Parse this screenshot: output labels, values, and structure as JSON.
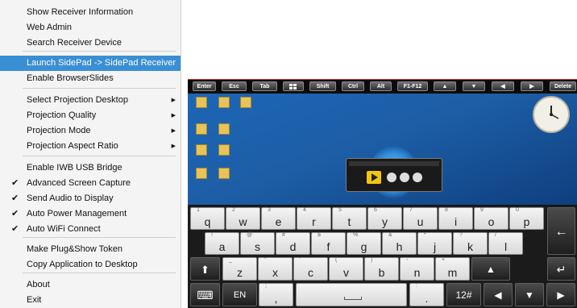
{
  "menu": {
    "items": [
      {
        "label": "Show Receiver Information",
        "checked": false,
        "submenu": false,
        "highlighted": false
      },
      {
        "label": "Web Admin",
        "checked": false,
        "submenu": false,
        "highlighted": false
      },
      {
        "label": "Search Receiver Device",
        "checked": false,
        "submenu": false,
        "highlighted": false
      },
      {
        "label": "Launch SidePad -> SidePad Receiver",
        "checked": false,
        "submenu": false,
        "highlighted": true
      },
      {
        "label": "Enable BrowserSlides",
        "checked": false,
        "submenu": false,
        "highlighted": false
      },
      {
        "label": "Select Projection Desktop",
        "checked": false,
        "submenu": true,
        "highlighted": false
      },
      {
        "label": "Projection Quality",
        "checked": false,
        "submenu": true,
        "highlighted": false
      },
      {
        "label": "Projection Mode",
        "checked": false,
        "submenu": true,
        "highlighted": false
      },
      {
        "label": "Projection Aspect Ratio",
        "checked": false,
        "submenu": true,
        "highlighted": false
      },
      {
        "label": "Enable IWB USB Bridge",
        "checked": false,
        "submenu": false,
        "highlighted": false
      },
      {
        "label": "Advanced Screen Capture",
        "checked": true,
        "submenu": false,
        "highlighted": false
      },
      {
        "label": "Send Audio to Display",
        "checked": true,
        "submenu": false,
        "highlighted": false
      },
      {
        "label": "Auto Power Management",
        "checked": true,
        "submenu": false,
        "highlighted": false
      },
      {
        "label": "Auto WiFi Connect",
        "checked": true,
        "submenu": false,
        "highlighted": false
      },
      {
        "label": "Make Plug&Show Token",
        "checked": false,
        "submenu": false,
        "highlighted": false
      },
      {
        "label": "Copy Application to Desktop",
        "checked": false,
        "submenu": false,
        "highlighted": false
      },
      {
        "label": "About",
        "checked": false,
        "submenu": false,
        "highlighted": false
      },
      {
        "label": "Exit",
        "checked": false,
        "submenu": false,
        "highlighted": false
      }
    ],
    "check_glyph": "✔",
    "submenu_glyph": "▶",
    "highlight_color": "#3a8fd4"
  },
  "toolbar": {
    "keys": [
      "Enter",
      "Esc",
      "Tab",
      "",
      "Shift",
      "Ctrl",
      "Alt",
      "F1-F12",
      "▲",
      "▼",
      "◀",
      "▶",
      "Delete"
    ],
    "windows_icon": "windows-logo-icon"
  },
  "keyboard": {
    "row1": [
      {
        "main": "q",
        "sub": "1"
      },
      {
        "main": "w",
        "sub": "2"
      },
      {
        "main": "e",
        "sub": "3"
      },
      {
        "main": "r",
        "sub": "4"
      },
      {
        "main": "t",
        "sub": "5"
      },
      {
        "main": "y",
        "sub": "6"
      },
      {
        "main": "u",
        "sub": "7"
      },
      {
        "main": "i",
        "sub": "8"
      },
      {
        "main": "o",
        "sub": "9"
      },
      {
        "main": "p",
        "sub": "0"
      }
    ],
    "row2": [
      {
        "main": "a",
        "sub": "!"
      },
      {
        "main": "s",
        "sub": "@"
      },
      {
        "main": "d",
        "sub": "#"
      },
      {
        "main": "f",
        "sub": "$"
      },
      {
        "main": "g",
        "sub": "%"
      },
      {
        "main": "h",
        "sub": "&"
      },
      {
        "main": "j",
        "sub": "*"
      },
      {
        "main": "k",
        "sub": "?"
      },
      {
        "main": "l",
        "sub": "/"
      }
    ],
    "row3": [
      {
        "main": "z",
        "sub": "_"
      },
      {
        "main": "x",
        "sub": "\""
      },
      {
        "main": "c",
        "sub": "'"
      },
      {
        "main": "v",
        "sub": "("
      },
      {
        "main": "b",
        "sub": ")"
      },
      {
        "main": "n",
        "sub": "-"
      },
      {
        "main": "m",
        "sub": "+"
      }
    ],
    "row4": {
      "lang": "EN",
      "comma": ",",
      "comma_sub": ";",
      "period": ".",
      "period_sub": ":",
      "symbols": "12#"
    },
    "glyphs": {
      "backspace": "←",
      "enter": "↵",
      "shift": "⬆",
      "up": "▲",
      "left": "◀",
      "down": "▼",
      "right": "▶",
      "kbd": "⌨",
      "space": "␣"
    }
  }
}
